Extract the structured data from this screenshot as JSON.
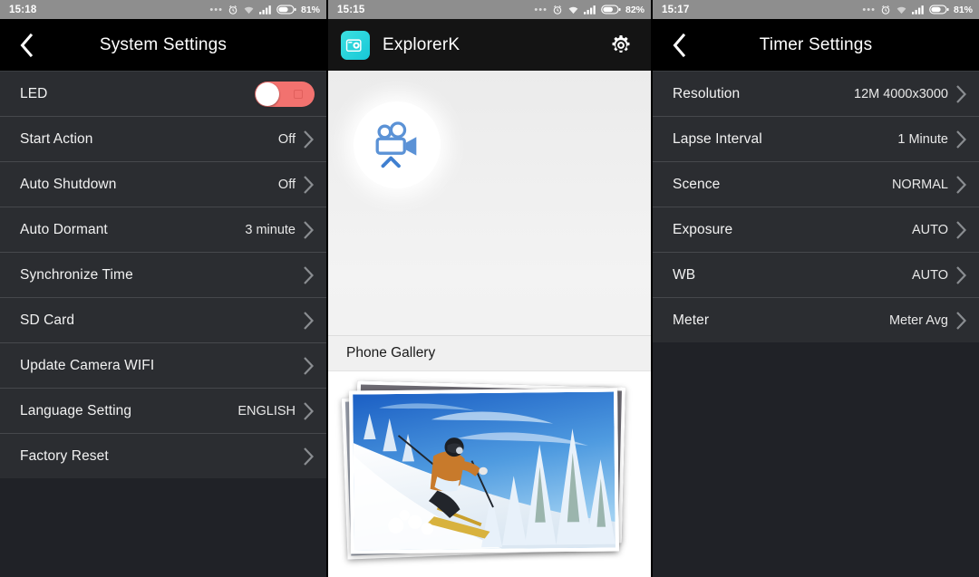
{
  "panels": {
    "left": {
      "statusbar": {
        "time": "15:18",
        "battery": "81%",
        "icons": [
          "more-dots-icon",
          "alarm-clock-icon",
          "wifi-icon",
          "signal-bars-icon",
          "battery-icon"
        ]
      },
      "titlebar": {
        "title": "System Settings",
        "back_icon": "back-chevron-icon"
      },
      "rows": [
        {
          "label": "LED",
          "value": "",
          "control": "toggle",
          "toggle_on": false
        },
        {
          "label": "Start Action",
          "value": "Off",
          "control": "chevron"
        },
        {
          "label": "Auto Shutdown",
          "value": "Off",
          "control": "chevron"
        },
        {
          "label": "Auto Dormant",
          "value": "3 minute",
          "control": "chevron"
        },
        {
          "label": "Synchronize Time",
          "value": "",
          "control": "chevron"
        },
        {
          "label": "SD Card",
          "value": "",
          "control": "chevron"
        },
        {
          "label": "Update Camera WIFI",
          "value": "",
          "control": "chevron"
        },
        {
          "label": "Language Setting",
          "value": "ENGLISH",
          "control": "chevron"
        },
        {
          "label": "Factory Reset",
          "value": "",
          "control": "chevron"
        }
      ]
    },
    "middle": {
      "statusbar": {
        "time": "15:15",
        "battery": "82%",
        "icons": [
          "more-dots-icon",
          "alarm-clock-icon",
          "wifi-icon",
          "signal-bars-icon",
          "battery-icon"
        ]
      },
      "appbar": {
        "title": "ExplorerK",
        "app_icon": "camera-app-icon",
        "settings_icon": "gear-icon"
      },
      "camera_button": {
        "icon": "movie-camera-icon",
        "sub_icon": "chevron-up-icon"
      },
      "gallery": {
        "header": "Phone Gallery",
        "photo": "skier-snow-photo"
      }
    },
    "right": {
      "statusbar": {
        "time": "15:17",
        "battery": "81%",
        "icons": [
          "more-dots-icon",
          "alarm-clock-icon",
          "wifi-icon",
          "signal-bars-icon",
          "battery-icon"
        ]
      },
      "titlebar": {
        "title": "Timer Settings",
        "back_icon": "back-chevron-icon"
      },
      "rows": [
        {
          "label": "Resolution",
          "value": "12M 4000x3000",
          "control": "chevron"
        },
        {
          "label": "Lapse Interval",
          "value": "1 Minute",
          "control": "chevron"
        },
        {
          "label": "Scence",
          "value": "NORMAL",
          "control": "chevron"
        },
        {
          "label": "Exposure",
          "value": "AUTO",
          "control": "chevron"
        },
        {
          "label": "WB",
          "value": "AUTO",
          "control": "chevron"
        },
        {
          "label": "Meter",
          "value": "Meter Avg",
          "control": "chevron"
        }
      ]
    }
  },
  "colors": {
    "statusbar_bg": "#8e8e8e",
    "titlebar_bg": "#000000",
    "row_bg": "#2b2d31",
    "row_divider": "#46484c",
    "toggle_on_color": "#f2726f",
    "app_icon_cyan": "#2fd6dd",
    "camera_icon_blue": "#5b92d6",
    "gallery_bg": "#ffffff"
  }
}
